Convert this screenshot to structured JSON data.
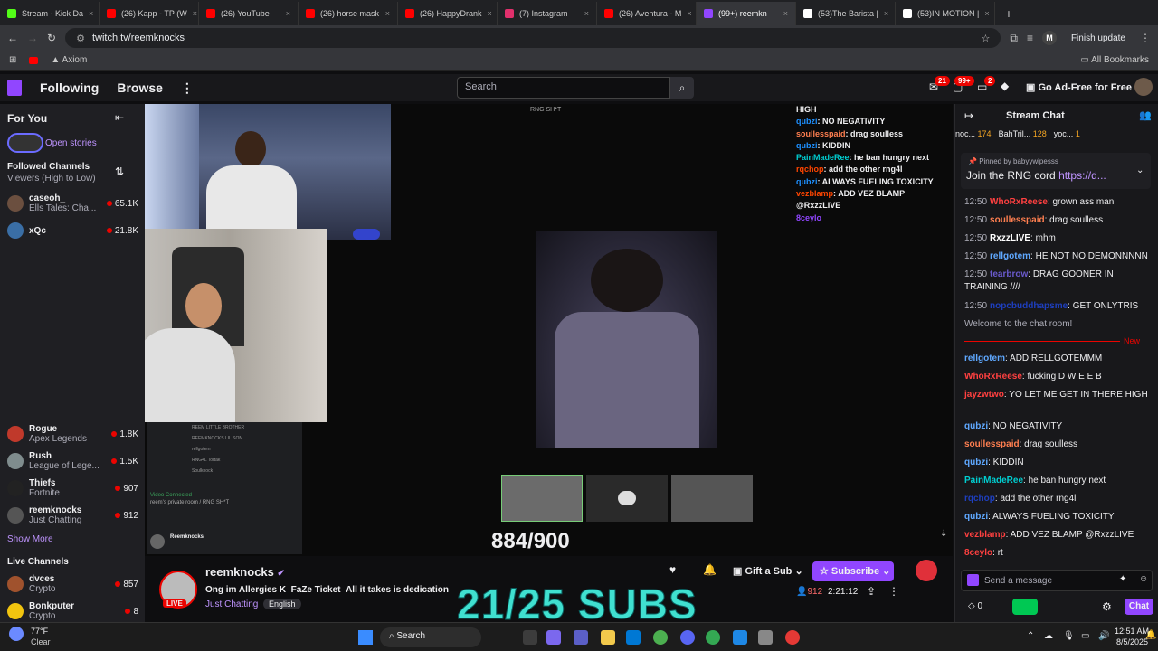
{
  "browser": {
    "tabs": [
      {
        "label": "Stream - Kick Da",
        "color": "#53fc18"
      },
      {
        "label": "(26) Kapp - TP (W",
        "color": "#ff0000"
      },
      {
        "label": "(26) YouTube",
        "color": "#ff0000"
      },
      {
        "label": "(26) horse mask",
        "color": "#ff0000"
      },
      {
        "label": "(26) HappyDrank",
        "color": "#ff0000"
      },
      {
        "label": "(7) Instagram",
        "color": "#e1306c"
      },
      {
        "label": "(26) Aventura - M",
        "color": "#ff0000"
      },
      {
        "label": "(99+) reemkn",
        "color": "#9146ff"
      },
      {
        "label": "(53)The Barista |",
        "color": "#ffffff"
      },
      {
        "label": "(53)IN MOTION |",
        "color": "#ffffff"
      }
    ],
    "url": "twitch.tv/reemknocks",
    "finish_update": "Finish update",
    "profile_initial": "M",
    "bookmark_axiom": "Axiom",
    "all_bookmarks": "All Bookmarks"
  },
  "twitch_nav": {
    "following": "Following",
    "browse": "Browse",
    "search_placeholder": "Search",
    "badge_inbox": "21",
    "badge_notifications": "99+",
    "badge_whispers": "2",
    "ad_free": "Go Ad-Free for Free"
  },
  "sidebar": {
    "for_you": "For You",
    "open_stories": "Open stories",
    "followed_channels": "Followed Channels",
    "sort": "Viewers (High to Low)",
    "channels_top": [
      {
        "name": "caseoh_",
        "game": "Ells Tales: Cha...",
        "viewers": "65.1K",
        "color": "#6b4f3f"
      },
      {
        "name": "xQc",
        "game": "",
        "viewers": "21.8K",
        "color": "#3a6ea5"
      }
    ],
    "channels": [
      {
        "name": "Rogue",
        "game": "Apex Legends",
        "viewers": "1.8K",
        "color": "#c0392b"
      },
      {
        "name": "Rush",
        "game": "League of Lege...",
        "viewers": "1.5K",
        "color": "#7f8c8d"
      },
      {
        "name": "Thiefs",
        "game": "Fortnite",
        "viewers": "907",
        "color": "#222222"
      },
      {
        "name": "reemknocks",
        "game": "Just Chatting",
        "viewers": "912",
        "color": "#555555"
      }
    ],
    "show_more": "Show More",
    "live_channels": "Live Channels",
    "live": [
      {
        "name": "dvces",
        "game": "Crypto",
        "viewers": "857",
        "color": "#a0522d"
      },
      {
        "name": "Bonkputer",
        "game": "Crypto",
        "viewers": "8",
        "color": "#f1c40f"
      }
    ]
  },
  "stream": {
    "overlay_title": "RNG SH*T",
    "sub_counter": "884/900",
    "subs_goal": "21/25 SUBS",
    "discord_connected": "Video Connected",
    "discord_room": "reem's private room / RNG SH*T",
    "discord_user": "Reemknocks",
    "discord_users": [
      "REEM LITTLE BROTHER",
      "REEMKNOCKS LIL SON",
      "rellgotem",
      "RNG4L Tortak",
      "Soulknock"
    ],
    "overlay_chat": [
      {
        "user": "",
        "text": "HIGH",
        "color": "#ffffff"
      },
      {
        "user": "qubzi",
        "text": "NO NEGATIVITY",
        "color": "#1e90ff"
      },
      {
        "user": "soullesspaid",
        "text": "drag soulless",
        "color": "#ff7f50"
      },
      {
        "user": "qubzi",
        "text": "KIDDIN",
        "color": "#1e90ff"
      },
      {
        "user": "PainMadeRee",
        "text": "he ban hungry next",
        "color": "#00ced1"
      },
      {
        "user": "rqchop",
        "text": "add the other rng4l",
        "color": "#ff4500"
      },
      {
        "user": "qubzi",
        "text": "ALWAYS FUELING TOXICITY",
        "color": "#1e90ff"
      },
      {
        "user": "vezblamp",
        "text": "ADD VEZ BLAMP",
        "color": "#ff4500"
      },
      {
        "user": "",
        "text": "@RxzzLIVE",
        "color": "#ffffff"
      },
      {
        "user": "8ceylo",
        "text": "",
        "color": "#9146ff"
      }
    ]
  },
  "channel_info": {
    "name": "reemknocks",
    "title_1": "Ong im Allergies K",
    "title_2": "FaZe Ticket",
    "title_3": "All it takes is dedication",
    "category": "Just Chatting",
    "tag": "English",
    "live": "LIVE",
    "viewers": "912",
    "uptime": "2:21:12",
    "gift": "Gift a Sub",
    "subscribe": "Subscribe"
  },
  "chat": {
    "title": "Stream Chat",
    "leaderboard": [
      {
        "user": "noc...",
        "count": "174"
      },
      {
        "user": "BahTril...",
        "count": "128"
      },
      {
        "user": "yoc...",
        "count": "1"
      }
    ],
    "pinned_by": "Pinned by",
    "pinned_user": "babyywipesss",
    "pinned_text": "Join the RNG cord",
    "pinned_link": "https://d...",
    "messages_top": [
      {
        "time": "12:50",
        "user": "WhoRxReese",
        "text": "grown ass man",
        "color": "#ff4040"
      },
      {
        "time": "12:50",
        "user": "soullesspaid",
        "text": "drag soulless",
        "color": "#ff7f50"
      },
      {
        "time": "12:50",
        "user": "RxzzLIVE",
        "text": "mhm",
        "color": "#ffffff"
      },
      {
        "time": "12:50",
        "user": "rellgotem",
        "text": "HE NOT NO DEMONNNNN",
        "color": "#5fa8ff"
      },
      {
        "time": "12:50",
        "user": "tearbrow",
        "text": "DRAG GOONER IN TRAINING ////",
        "color": "#6a5acd"
      },
      {
        "time": "12:50",
        "user": "nopcbuddhapsme",
        "text": "GET ONLYTRIS",
        "color": "#1e3fbf"
      }
    ],
    "welcome": "Welcome to the chat room!",
    "new_label": "New",
    "messages": [
      {
        "user": "rellgotem",
        "text": "ADD RELLGOTEMMM",
        "color": "#5fa8ff"
      },
      {
        "user": "WhoRxReese",
        "text": "fucking D W E E B",
        "color": "#ff4040"
      },
      {
        "user": "jayzwtwo",
        "text": "YO LET ME GET IN THERE HIGH",
        "color": "#ff4040"
      },
      {
        "user": "qubzi",
        "text": "NO NEGATIVITY",
        "color": "#5fa8ff"
      },
      {
        "user": "soullesspaid",
        "text": "drag soulless",
        "color": "#ff7f50"
      },
      {
        "user": "qubzi",
        "text": "KIDDIN",
        "color": "#5fa8ff"
      },
      {
        "user": "PainMadeRee",
        "text": "he ban hungry next",
        "color": "#00ced1"
      },
      {
        "user": "rqchop",
        "text": "add the other rng4l",
        "color": "#1e3fbf"
      },
      {
        "user": "qubzi",
        "text": "ALWAYS FUELING TOXICITY",
        "color": "#5fa8ff"
      },
      {
        "user": "vezblamp",
        "text": "ADD VEZ BLAMP @RxzzLIVE",
        "color": "#ff4040"
      },
      {
        "user": "8ceylo",
        "text": "rt",
        "color": "#ff4040"
      }
    ],
    "input_placeholder": "Send a message",
    "points": "0",
    "chat_button": "Chat"
  },
  "taskbar": {
    "weather_temp": "77°F",
    "weather_desc": "Clear",
    "search": "Search",
    "time": "12:51 AM",
    "date": "8/5/2025"
  }
}
